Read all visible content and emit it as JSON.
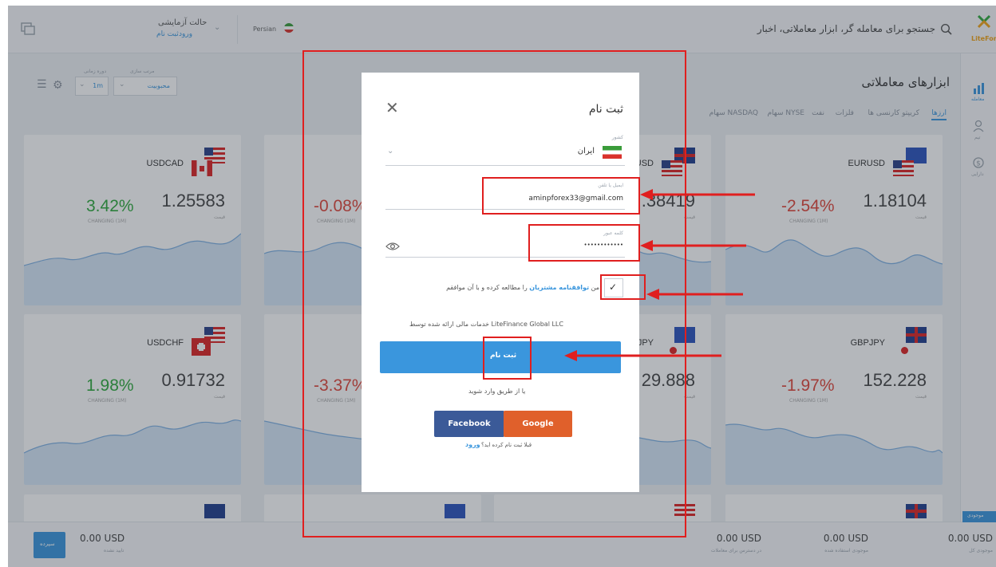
{
  "topbar": {
    "search_placeholder": "جستجو برای معامله گر، ابزار معاملاتی، اخبار",
    "account_mode": "حالت آزمایشی",
    "login": "ورود",
    "register": "ثبت نام",
    "language": "Persian"
  },
  "logo": {
    "text": "LiteForex"
  },
  "page": {
    "title": "ابزارهای معاملاتی",
    "tabs": [
      "ارزها",
      "کریپتو کارنسی ها",
      "فلزات",
      "نفت",
      "سهام NYSE",
      "سهام NASDAQ"
    ],
    "filter_sort_label": "مرتب سازی",
    "filter_sort_value": "محبوبیت",
    "filter_period_label": "دوره زمانی",
    "filter_period_value": "1m"
  },
  "rightbar": {
    "items": [
      "معامله",
      "تیم",
      "دارایی"
    ]
  },
  "cards": [
    {
      "symbol": "EURUSD",
      "price": "1.18104",
      "change": "-2.54%",
      "trend": "neg",
      "flag": "eu-us"
    },
    {
      "symbol": "USD",
      "price": ".38419",
      "change": "",
      "trend": "neg",
      "flag": "gb-us"
    },
    {
      "symbol": "",
      "price": "",
      "change": "-0.08%",
      "trend": "neg",
      "flag": ""
    },
    {
      "symbol": "USDCAD",
      "price": "1.25583",
      "change": "3.42%",
      "trend": "pos",
      "flag": "us-ca"
    },
    {
      "symbol": "GBPJPY",
      "price": "152.228",
      "change": "-1.97%",
      "trend": "neg",
      "flag": "gb-jp"
    },
    {
      "symbol": "JPY",
      "price": "29.888",
      "change": "",
      "trend": "neg",
      "flag": "eu-jp"
    },
    {
      "symbol": "",
      "price": "",
      "change": "-3.37%",
      "trend": "neg",
      "flag": ""
    },
    {
      "symbol": "USDCHF",
      "price": "0.91732",
      "change": "1.98%",
      "trend": "pos",
      "flag": "us-ch"
    }
  ],
  "card_captions": {
    "price": "قیمت",
    "change": "CHANGING (1M)"
  },
  "modal": {
    "title": "ثبت نام",
    "country_label": "کشور",
    "country_value": "ایران",
    "email_label": "ایمیل یا تلفن",
    "email_value": "aminpforex33@gmail.com",
    "password_label": "کلمه عبور",
    "password_value": "••••••••••••",
    "agree_prefix": "من",
    "agree_link": "توافقنامه مشتریان",
    "agree_suffix": "را مطالعه کرده و با آن موافقم",
    "provider": "خدمات مالی ارائه شده توسط LiteFinance Global LLC",
    "submit": "ثبت نام",
    "or_social": "یا از طریق وارد شوید",
    "facebook": "Facebook",
    "google": "Google",
    "already": "قبلا ثبت نام کرده اید؟",
    "login_link": "ورود"
  },
  "bottombar": {
    "deposit_button": "سپرده",
    "stats": [
      {
        "value": "0.00 USD",
        "label": "تایید نشده"
      },
      {
        "value": "0.00 USD",
        "label": "در دسترس برای معاملات"
      },
      {
        "value": "0.00 USD",
        "label": "موجودی استفاده شده"
      },
      {
        "value": "0.00 USD",
        "label": "موجودی کل"
      }
    ],
    "side_tag": "موجودی"
  },
  "colors": {
    "accent": "#3a96dd",
    "positive": "#2eaa3c",
    "negative": "#e0453a",
    "annotation": "#e01f1f"
  }
}
